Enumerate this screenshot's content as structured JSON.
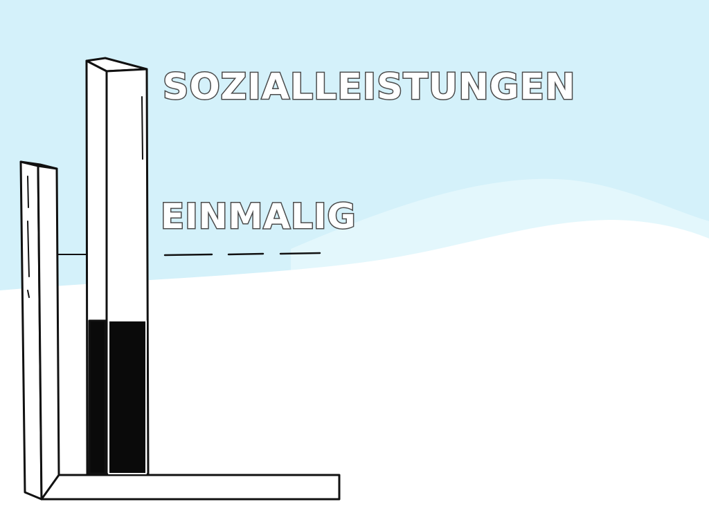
{
  "labels": {
    "title": "SOZIALLEISTUNGEN",
    "level": "EINMALIG"
  },
  "colors": {
    "sky": "#d4f1fa",
    "sky_light": "#e3f7fc",
    "ground": "#ffffff",
    "outline": "#111111",
    "fill_dark": "#0a0a0a",
    "text_outline": "#4a4a4a"
  },
  "bar": {
    "filled_fraction": 0.38
  }
}
